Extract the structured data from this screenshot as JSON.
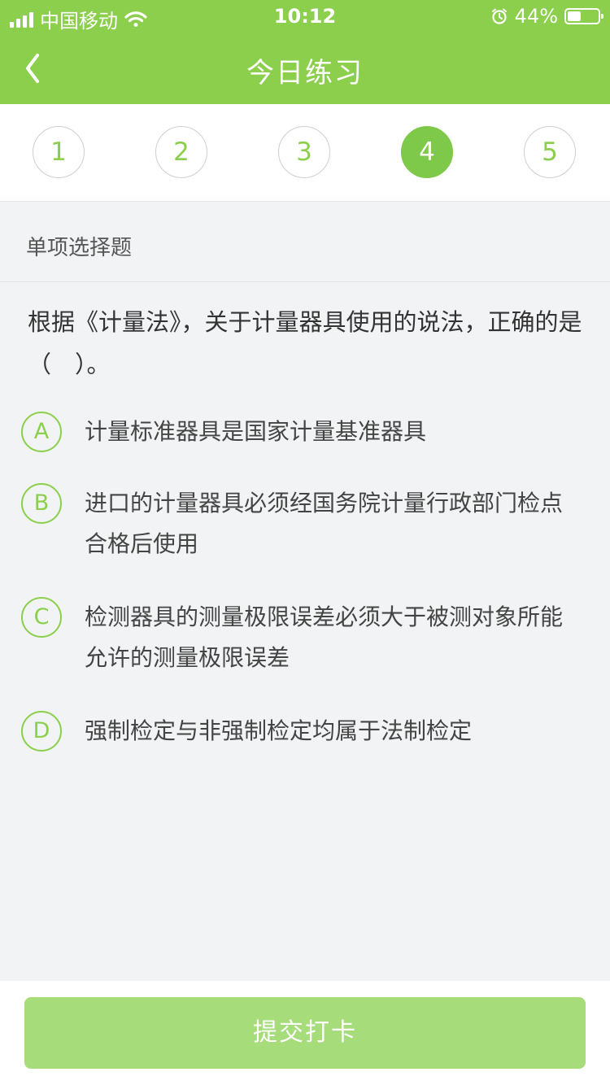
{
  "status": {
    "carrier": "中国移动",
    "time": "10:12",
    "battery": "44%",
    "battery_level": 0.44,
    "signal_bars": 4,
    "icons": [
      "signal-icon",
      "wifi-icon",
      "alarm-icon",
      "battery-icon"
    ]
  },
  "header": {
    "title": "今日练习",
    "back_icon": "chevron-left-icon"
  },
  "question_nav": {
    "items": [
      "1",
      "2",
      "3",
      "4",
      "5"
    ],
    "active_index": 3
  },
  "section": {
    "label": "单项选择题"
  },
  "question": {
    "text": "根据《计量法》，关于计量器具使用的说法，正确的是（　）。",
    "options": [
      {
        "letter": "A",
        "text": "计量标准器具是国家计量基准器具"
      },
      {
        "letter": "B",
        "text": "进口的计量器具必须经国务院计量行政部门检点合格后使用"
      },
      {
        "letter": "C",
        "text": "检测器具的测量极限误差必须大于被测对象所能允许的测量极限误差"
      },
      {
        "letter": "D",
        "text": "强制检定与非强制检定均属于法制检定"
      }
    ]
  },
  "footer": {
    "submit_label": "提交打卡"
  },
  "colors": {
    "primary": "#8bcf4c",
    "active_circle": "#7ec84a",
    "button": "#a6dc79",
    "background": "#f2f3f5"
  }
}
